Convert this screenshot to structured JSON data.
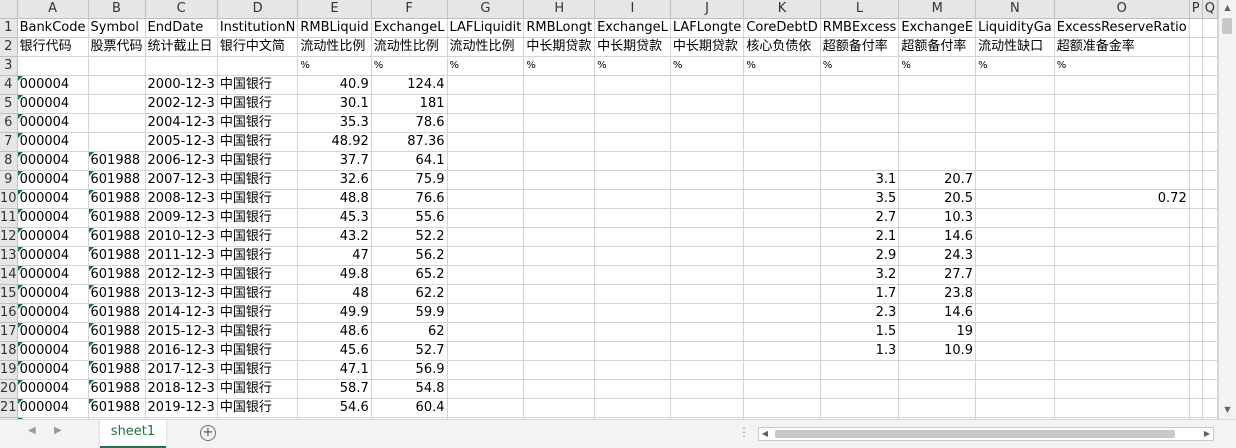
{
  "columns": [
    "A",
    "B",
    "C",
    "D",
    "E",
    "F",
    "G",
    "H",
    "I",
    "J",
    "K",
    "L",
    "M",
    "N",
    "O",
    "P",
    "Q"
  ],
  "rows": [
    {
      "n": "1",
      "c": [
        "BankCode",
        "Symbol",
        "EndDate",
        "InstitutionN",
        "RMBLiquid",
        "ExchangeL",
        "LAFLiquidit",
        "RMBLongt",
        "ExchangeL",
        "LAFLongte",
        "CoreDebtD",
        "RMBExcess",
        "ExchangeE",
        "LiquidityGa",
        "ExcessReserveRatio",
        "",
        ""
      ]
    },
    {
      "n": "2",
      "c": [
        "银行代码",
        "股票代码",
        "统计截止日",
        "银行中文简",
        "流动性比例",
        "流动性比例",
        "流动性比例",
        "中长期贷款",
        "中长期贷款",
        "中长期贷款",
        "核心负债依",
        "超额备付率",
        "超额备付率",
        "流动性缺口",
        "超额准备金率",
        "",
        ""
      ]
    },
    {
      "n": "3",
      "c": [
        "",
        "",
        "",
        "",
        "%",
        "%",
        "%",
        "%",
        "%",
        "%",
        "%",
        "%",
        "%",
        "%",
        "%",
        "",
        ""
      ]
    },
    {
      "n": "4",
      "c": [
        "000004",
        "",
        "2000-12-3",
        "中国银行",
        "40.9",
        "124.4",
        "",
        "",
        "",
        "",
        "",
        "",
        "",
        "",
        "",
        "",
        ""
      ]
    },
    {
      "n": "5",
      "c": [
        "000004",
        "",
        "2002-12-3",
        "中国银行",
        "30.1",
        "181",
        "",
        "",
        "",
        "",
        "",
        "",
        "",
        "",
        "",
        "",
        ""
      ]
    },
    {
      "n": "6",
      "c": [
        "000004",
        "",
        "2004-12-3",
        "中国银行",
        "35.3",
        "78.6",
        "",
        "",
        "",
        "",
        "",
        "",
        "",
        "",
        "",
        "",
        ""
      ]
    },
    {
      "n": "7",
      "c": [
        "000004",
        "",
        "2005-12-3",
        "中国银行",
        "48.92",
        "87.36",
        "",
        "",
        "",
        "",
        "",
        "",
        "",
        "",
        "",
        "",
        ""
      ]
    },
    {
      "n": "8",
      "c": [
        "000004",
        "601988",
        "2006-12-3",
        "中国银行",
        "37.7",
        "64.1",
        "",
        "",
        "",
        "",
        "",
        "",
        "",
        "",
        "",
        "",
        ""
      ]
    },
    {
      "n": "9",
      "c": [
        "000004",
        "601988",
        "2007-12-3",
        "中国银行",
        "32.6",
        "75.9",
        "",
        "",
        "",
        "",
        "",
        "3.1",
        "20.7",
        "",
        "",
        "",
        ""
      ]
    },
    {
      "n": "10",
      "c": [
        "000004",
        "601988",
        "2008-12-3",
        "中国银行",
        "48.8",
        "76.6",
        "",
        "",
        "",
        "",
        "",
        "3.5",
        "20.5",
        "",
        "0.72",
        "",
        ""
      ]
    },
    {
      "n": "11",
      "c": [
        "000004",
        "601988",
        "2009-12-3",
        "中国银行",
        "45.3",
        "55.6",
        "",
        "",
        "",
        "",
        "",
        "2.7",
        "10.3",
        "",
        "",
        "",
        ""
      ]
    },
    {
      "n": "12",
      "c": [
        "000004",
        "601988",
        "2010-12-3",
        "中国银行",
        "43.2",
        "52.2",
        "",
        "",
        "",
        "",
        "",
        "2.1",
        "14.6",
        "",
        "",
        "",
        ""
      ]
    },
    {
      "n": "13",
      "c": [
        "000004",
        "601988",
        "2011-12-3",
        "中国银行",
        "47",
        "56.2",
        "",
        "",
        "",
        "",
        "",
        "2.9",
        "24.3",
        "",
        "",
        "",
        ""
      ]
    },
    {
      "n": "14",
      "c": [
        "000004",
        "601988",
        "2012-12-3",
        "中国银行",
        "49.8",
        "65.2",
        "",
        "",
        "",
        "",
        "",
        "3.2",
        "27.7",
        "",
        "",
        "",
        ""
      ]
    },
    {
      "n": "15",
      "c": [
        "000004",
        "601988",
        "2013-12-3",
        "中国银行",
        "48",
        "62.2",
        "",
        "",
        "",
        "",
        "",
        "1.7",
        "23.8",
        "",
        "",
        "",
        ""
      ]
    },
    {
      "n": "16",
      "c": [
        "000004",
        "601988",
        "2014-12-3",
        "中国银行",
        "49.9",
        "59.9",
        "",
        "",
        "",
        "",
        "",
        "2.3",
        "14.6",
        "",
        "",
        "",
        ""
      ]
    },
    {
      "n": "17",
      "c": [
        "000004",
        "601988",
        "2015-12-3",
        "中国银行",
        "48.6",
        "62",
        "",
        "",
        "",
        "",
        "",
        "1.5",
        "19",
        "",
        "",
        "",
        ""
      ]
    },
    {
      "n": "18",
      "c": [
        "000004",
        "601988",
        "2016-12-3",
        "中国银行",
        "45.6",
        "52.7",
        "",
        "",
        "",
        "",
        "",
        "1.3",
        "10.9",
        "",
        "",
        "",
        ""
      ]
    },
    {
      "n": "19",
      "c": [
        "000004",
        "601988",
        "2017-12-3",
        "中国银行",
        "47.1",
        "56.9",
        "",
        "",
        "",
        "",
        "",
        "",
        "",
        "",
        "",
        "",
        ""
      ]
    },
    {
      "n": "20",
      "c": [
        "000004",
        "601988",
        "2018-12-3",
        "中国银行",
        "58.7",
        "54.8",
        "",
        "",
        "",
        "",
        "",
        "",
        "",
        "",
        "",
        "",
        ""
      ]
    },
    {
      "n": "21",
      "c": [
        "000004",
        "601988",
        "2019-12-3",
        "中国银行",
        "54.6",
        "60.4",
        "",
        "",
        "",
        "",
        "",
        "",
        "",
        "",
        "",
        "",
        ""
      ]
    },
    {
      "n": "22",
      "c": [
        "",
        "",
        "",
        "",
        "",
        "",
        "",
        "",
        "",
        "",
        "",
        "",
        "",
        "",
        "",
        "",
        ""
      ]
    }
  ],
  "sheet_tab": "sheet1",
  "add_sheet_symbol": "+",
  "nav_prev": "◀",
  "nav_next": "▶",
  "more_dots": "⋮",
  "icons": {
    "add": "add-sheet-icon",
    "scroll_up": "triangle-up-icon",
    "scroll_down": "triangle-down-icon",
    "scroll_left": "triangle-left-icon",
    "scroll_right": "triangle-right-icon"
  },
  "colors": {
    "accent": "#217346",
    "header_bg": "#e6e6e6",
    "gridline": "#d4d4d4",
    "marker": "#107c41"
  }
}
